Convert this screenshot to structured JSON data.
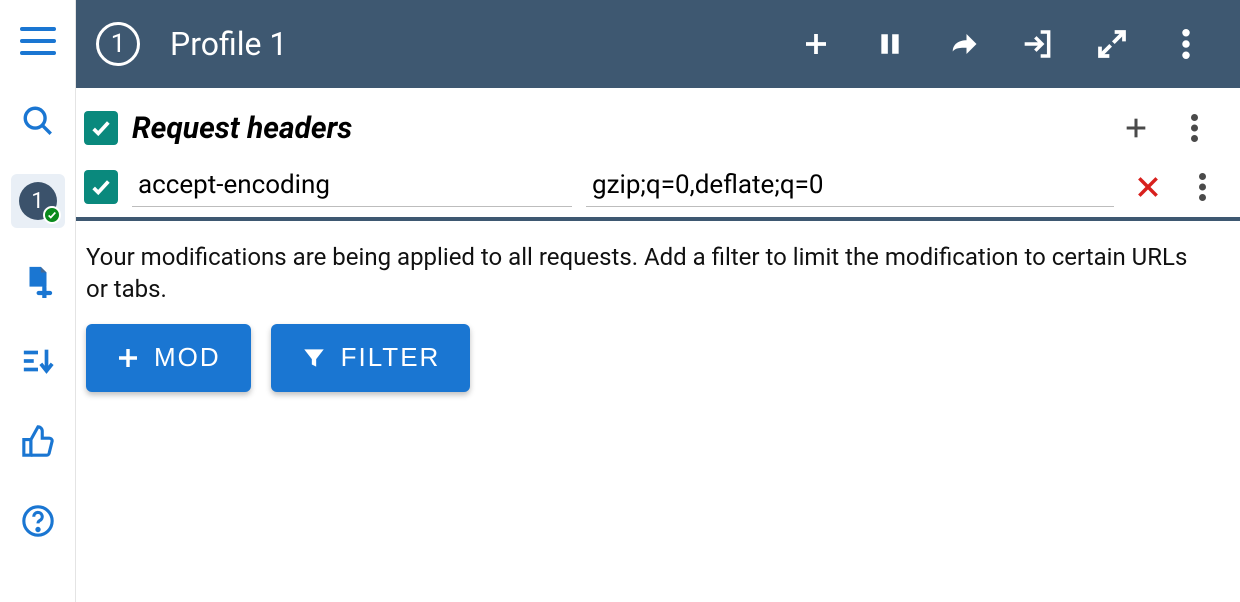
{
  "header": {
    "profile_number": "1",
    "title": "Profile 1"
  },
  "sidebar": {
    "active_profile_number": "1"
  },
  "section": {
    "title": "Request headers"
  },
  "entry": {
    "name": "accept-encoding",
    "value": "gzip;q=0,deflate;q=0"
  },
  "info": {
    "text": "Your modifications are being applied to all requests. Add a filter to limit the modification to certain URLs or tabs.",
    "mod_label": "MOD",
    "filter_label": "FILTER"
  }
}
